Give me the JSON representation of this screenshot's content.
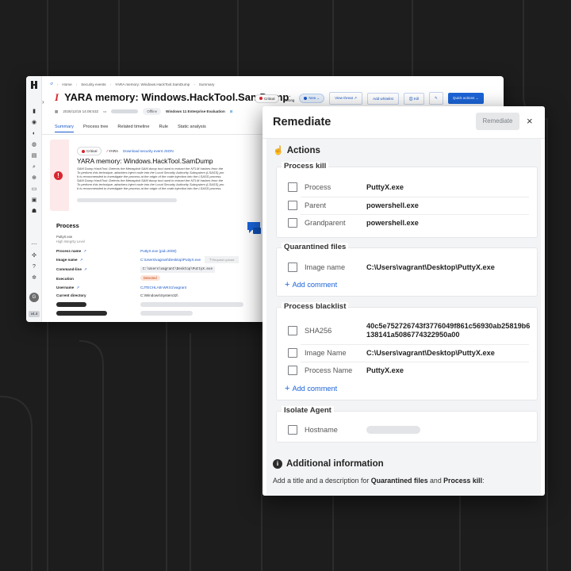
{
  "app": {
    "breadcrumbs": [
      "Home",
      "Security events",
      "YARA memory: Windows.HackTool.SamDump",
      "Summary"
    ],
    "title_mark": "I",
    "title": "YARA memory: Windows.HackTool.SamDump",
    "critical_label": "Critical",
    "strong_label": "Strong",
    "status_label": "New",
    "buttons": [
      "View threat",
      "Add whitelist",
      "Kill",
      "Quick actions"
    ],
    "timestamp": "2025/12/15 14:06:532",
    "offline_label": "Offline",
    "os_label": "Windows 11 Enterprise Evaluation",
    "tabs": [
      "Summary",
      "Process tree",
      "Related timeline",
      "Rule",
      "Static analysis"
    ],
    "alert": {
      "critical": "Critical",
      "rule_type": "YARA",
      "download_link": "Download security event JSON",
      "title": "YARA memory: Windows.HackTool.SamDump",
      "description": [
        "SAM Dump HackTool: Detects the Metasploit SAM dump tool used to extract the NTLM hashes from the",
        "To perform this technique, attackers inject code into the Local Security Authority Subsystem (LSASS) pro",
        "It is recommended to investigate the process at the origin of the code injection into the LSASS process.",
        "SAM Dump HackTool: Detects the Metasploit SAM dump tool used to extract the NTLM hashes from the",
        "To perform this technique, attackers inject code into the Local Security Authority Subsystem (LSASS) pro",
        "It is recommended to investigate the process at the origin of the code injection into the LSASS process."
      ]
    },
    "process": {
      "title": "Process",
      "sub_name": "PuttyX.exe",
      "sub_level": "High Integrity Level",
      "rows": [
        {
          "label": "Process name",
          "value": "PuttyX.exe (pid=2000)"
        },
        {
          "label": "Image name",
          "value": "C:\\Users\\vagrant\\Desktop\\PuttyX.exe",
          "extra": "Request upload"
        },
        {
          "label": "Command-line",
          "value": "C:\\Users\\vagrant\\Desktop\\PuttyX.exe"
        },
        {
          "label": "Execution",
          "value": "Detected"
        },
        {
          "label": "Username",
          "value": "CJTECHLAB-WKS1\\vagrant"
        },
        {
          "label": "Current directory",
          "value": "C:\\Windows\\System32\\"
        }
      ]
    },
    "version": "v4.4"
  },
  "panel": {
    "title": "Remediate",
    "button": "Remediate",
    "close": "×",
    "actions_title": "Actions",
    "process_kill": {
      "title": "Process kill",
      "rows": [
        {
          "label": "Process",
          "value": "PuttyX.exe"
        },
        {
          "label": "Parent",
          "value": "powershell.exe"
        },
        {
          "label": "Grandparent",
          "value": "powershell.exe"
        }
      ]
    },
    "quarantined": {
      "title": "Quarantined files",
      "rows": [
        {
          "label": "Image name",
          "value": "C:\\Users\\vagrant\\Desktop\\PuttyX.exe"
        }
      ],
      "add_comment": "Add comment"
    },
    "blacklist": {
      "title": "Process blacklist",
      "rows": [
        {
          "label": "SHA256",
          "value": "40c5e752726743f3776049f861c56930ab25819b6138141a5086774322950a00"
        },
        {
          "label": "Image Name",
          "value": "C:\\Users\\vagrant\\Desktop\\PuttyX.exe"
        },
        {
          "label": "Process Name",
          "value": "PuttyX.exe"
        }
      ],
      "add_comment": "Add comment"
    },
    "isolate": {
      "title": "Isolate Agent",
      "rows": [
        {
          "label": "Hostname",
          "value": ""
        }
      ]
    },
    "additional": {
      "title": "Additional information",
      "text_prefix": "Add a title and a description for ",
      "bold1": "Quarantined files",
      "mid": " and ",
      "bold2": "Process kill",
      "suffix": ":"
    }
  },
  "colors": {
    "accent": "#1b64d8",
    "critical": "#d9262f",
    "background": "#1d1d1d"
  }
}
